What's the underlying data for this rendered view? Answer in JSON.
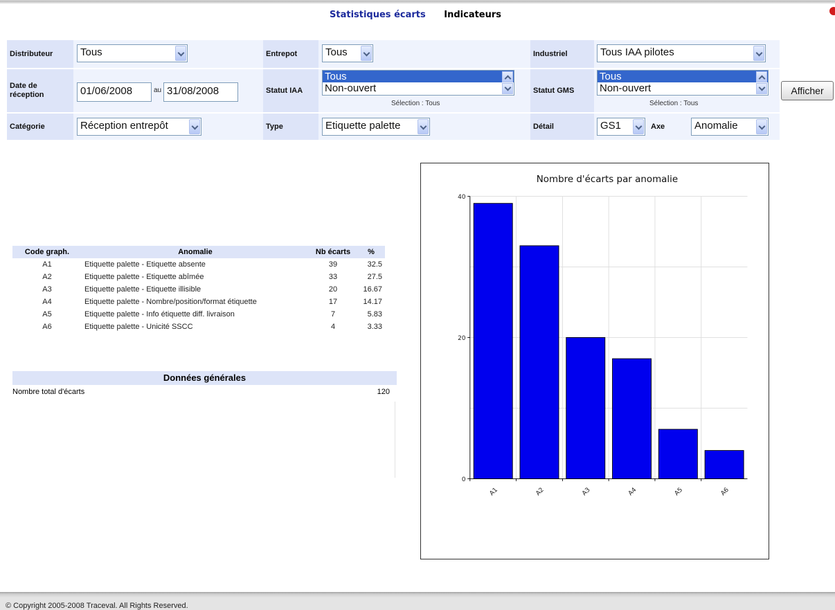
{
  "tabs": {
    "stats": "Statistiques écarts",
    "indicators": "Indicateurs"
  },
  "filters": {
    "distributeur": {
      "label": "Distributeur",
      "value": "Tous"
    },
    "entrepot": {
      "label": "Entrepot",
      "value": "Tous"
    },
    "industriel": {
      "label": "Industriel",
      "value": "Tous IAA pilotes"
    },
    "date": {
      "label_line1": "Date de",
      "label_line2": "réception",
      "from": "01/06/2008",
      "separator": "au",
      "to": "31/08/2008"
    },
    "statut_iaa": {
      "label": "Statut IAA",
      "options": [
        "Tous",
        "Non-ouvert"
      ],
      "selection": "Sélection : Tous"
    },
    "statut_gms": {
      "label": "Statut GMS",
      "options": [
        "Tous",
        "Non-ouvert"
      ],
      "selection": "Sélection : Tous"
    },
    "categorie": {
      "label": "Catégorie",
      "value": "Réception entrepôt"
    },
    "type": {
      "label": "Type",
      "value": "Etiquette palette"
    },
    "detail": {
      "label": "Détail",
      "value": "GS1"
    },
    "axe": {
      "label": "Axe",
      "value": "Anomalie"
    },
    "submit": "Afficher"
  },
  "table": {
    "headers": [
      "Code graph.",
      "Anomalie",
      "Nb écarts",
      "%"
    ],
    "rows": [
      [
        "A1",
        "Etiquette palette - Etiquette absente",
        "39",
        "32.5"
      ],
      [
        "A2",
        "Etiquette palette - Etiquette abîmée",
        "33",
        "27.5"
      ],
      [
        "A3",
        "Etiquette palette - Etiquette illisible",
        "20",
        "16.67"
      ],
      [
        "A4",
        "Etiquette palette - Nombre/position/format étiquette",
        "17",
        "14.17"
      ],
      [
        "A5",
        "Etiquette palette - Info étiquette diff. livraison",
        "7",
        "5.83"
      ],
      [
        "A6",
        "Etiquette palette - Unicité SSCC",
        "4",
        "3.33"
      ]
    ]
  },
  "general": {
    "title": "Données générales",
    "total_label": "Nombre total d'écarts",
    "total_value": "120"
  },
  "chart_data": {
    "type": "bar",
    "title": "Nombre d'écarts par anomalie",
    "categories": [
      "A1",
      "A2",
      "A3",
      "A4",
      "A5",
      "A6"
    ],
    "values": [
      39,
      33,
      20,
      17,
      7,
      4
    ],
    "ylim": [
      0,
      40
    ],
    "yticks": [
      0,
      20,
      40
    ],
    "grid": true,
    "bar_color": "#0000ee"
  },
  "footer": "© Copyright 2005-2008 Traceval. All Rights Reserved."
}
